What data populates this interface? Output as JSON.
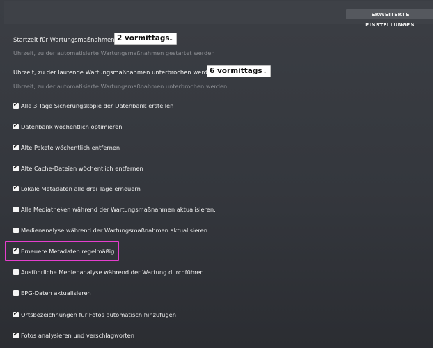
{
  "header": {
    "advanced_button_label": "ERWEITERTE EINSTELLUNGEN"
  },
  "start_time": {
    "label": "Startzeit für Wartungsmaßnahmen",
    "value": "2 vormittags",
    "hint": "Uhrzeit, zu der automatisierte Wartungsmaßnahmen gestartet werden"
  },
  "stop_time": {
    "label": "Uhrzeit, zu der laufende Wartungsmaßnahmen unterbrochen werden",
    "value": "6 vormittags",
    "hint": "Uhrzeit, zu der automatisierte Wartungsmaßnahmen unterbrochen werden"
  },
  "tasks": [
    {
      "label": "Alle 3 Tage Sicherungskopie der Datenbank erstellen",
      "checked": true
    },
    {
      "label": "Datenbank wöchentlich optimieren",
      "checked": true
    },
    {
      "label": "Alte Pakete wöchentlich entfernen",
      "checked": true
    },
    {
      "label": "Alte Cache-Dateien wöchentlich entfernen",
      "checked": true
    },
    {
      "label": "Lokale Metadaten alle drei Tage erneuern",
      "checked": true
    },
    {
      "label": "Alle Mediatheken während der Wartungsmaßnahmen aktualisieren.",
      "checked": false
    },
    {
      "label": "Medienanalyse während der Wartungsmaßnahmen aktualisieren.",
      "checked": false
    },
    {
      "label": "Erneuere Metadaten regelmäßig",
      "checked": true
    },
    {
      "label": "Ausführliche Medienanalyse während der Wartung durchführen",
      "checked": false
    },
    {
      "label": "EPG-Daten aktualisieren",
      "checked": false
    },
    {
      "label": "Ortsbezeichnungen für Fotos automatisch hinzufügen",
      "checked": true
    },
    {
      "label": "Fotos analysieren und verschlagworten",
      "checked": true
    }
  ],
  "colors": {
    "highlight": "#e53ecd",
    "background": "#36393f"
  },
  "icons": {
    "check": "check-icon",
    "dropdown": "chevron-down-icon"
  }
}
